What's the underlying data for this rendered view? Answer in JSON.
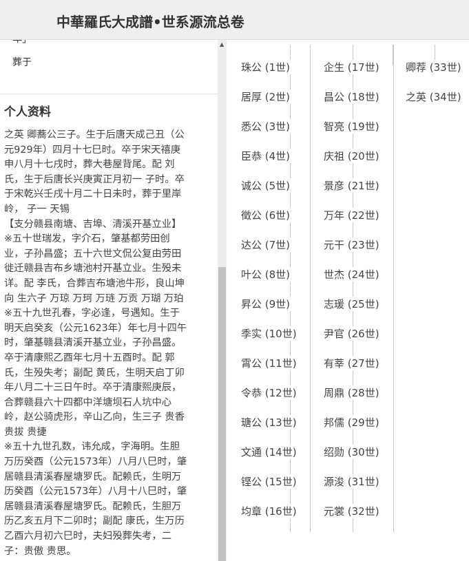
{
  "header": {
    "title": "中華羅氏大成譜•世系源流总卷"
  },
  "left": {
    "cut_line": "年」",
    "burial": "葬于",
    "section_title": "个人资料",
    "bio_lines": [
      "之英 卿蕎公三子。生于后唐天成己丑（公",
      "元929年）四月十七巳时。卒于宋天禧庚",
      "申八月十七戌时，葬大巷屋背尾。配 刘",
      "氏，生于后唐长兴庚寅正月初一 子时。卒",
      "于宋乾兴壬戌十月二十日未时，葬于里岸",
      "岭， 子一  天锡",
      "【支分赣县南塘、吉埠、清溪开基立业】",
      "※五十世瑞发，字介石，肇基都劳田创",
      "业，子孙昌盛；五十六世文侃公复由劳田",
      "徙迁赣县吉布乡塘池村开基立业。生殁未",
      "详。配 李氏，合葬吉布塘池牛形，良山坤",
      "向 生六子 万琼 万珂 万琏 万贡 万瑚 万珀",
      "※五十九世孔春，字必逢，号遇知。生于",
      "明天启癸亥（公元1623年）年七月十四午",
      "时，肇基赣县清溪开基立业，子孙昌盛。",
      "卒于清康熙乙酉年七月十五酉时。配 郭",
      "氏，生殁失考；副配 黄氏，生明天启丁卯",
      "年八月二十三日午时。卒于清康熙庚辰，",
      "合葬赣县六十四都中洋塘坝石人坑中心",
      "岭，赵公骑虎形，辛山乙向，生三子 贵香",
      "贵拔 贵捷",
      "※五十九世孔数，讳允成，字海明。生胆",
      "万历癸酉（公元1573年）八月八巳时，肇",
      "居赣县清溪春屋塘罗氏。配赖氏，生明万",
      "历癸酉（公元1573年）八月十八巳时，肇",
      "居赣县清溪春屋塘罗氏。配赖氏，生胆万",
      "历乙亥五月下二卯时；副配 康氏，生万历",
      "乙酉六月初六巳时，夫妇殁葬失考，二",
      "子：贵傲 贵思。"
    ]
  },
  "scrollbar": {
    "up_arrow": "▲"
  },
  "lineage": {
    "columns": [
      [
        "珠公 (1世)",
        "居厚 (2世)",
        "悉公 (3世)",
        "臣恭 (4世)",
        "诚公 (5世)",
        "徵公 (6世)",
        "达公 (7世)",
        "叶公 (8世)",
        "昇公 (9世)",
        "季实 (10世)",
        "霄公 (11世)",
        "令恭 (12世)",
        "瑭公 (13世)",
        "文通 (14世)",
        "铿公 (15世)",
        "均章 (16世)"
      ],
      [
        "企生 (17世)",
        "昌公 (18世)",
        "智亮 (19世)",
        "庆祖 (20世)",
        "景彦 (21世)",
        "万年 (22世)",
        "元干 (23世)",
        "世杰 (24世)",
        "志瑗 (25世)",
        "尹官 (26世)",
        "有莘 (27世)",
        "周鼎 (28世)",
        "邦儒 (29世)",
        "绍勋 (30世)",
        "源浚 (31世)",
        "元裳 (32世)"
      ],
      [
        "卿荐 (33世)",
        "之英 (34世)"
      ]
    ]
  }
}
